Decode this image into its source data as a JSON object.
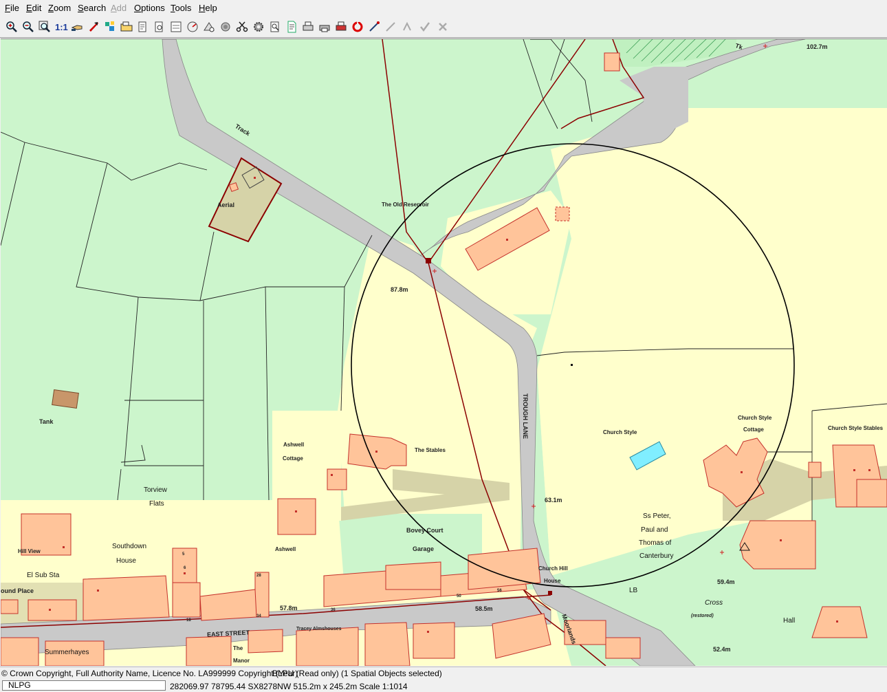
{
  "menu": [
    {
      "label": "File",
      "u": "F",
      "rest": "ile",
      "enabled": true
    },
    {
      "label": "Edit",
      "u": "E",
      "rest": "dit",
      "enabled": true
    },
    {
      "label": "Zoom",
      "u": "Z",
      "rest": "oom",
      "enabled": true
    },
    {
      "label": "Search",
      "u": "S",
      "rest": "earch",
      "enabled": true
    },
    {
      "label": "Add",
      "u": "A",
      "rest": "dd",
      "enabled": false
    },
    {
      "label": "Options",
      "u": "O",
      "rest": "ptions",
      "enabled": true
    },
    {
      "label": "Tools",
      "u": "T",
      "rest": "ools",
      "enabled": true
    },
    {
      "label": "Help",
      "u": "H",
      "rest": "elp",
      "enabled": true
    }
  ],
  "toolbar": {
    "scale_label": "1:1",
    "icons": [
      "zoom-in-icon",
      "zoom-out-icon",
      "zoom-extent-icon",
      "scale-1-1",
      "pan-hand-icon",
      "select-arrow-icon",
      "layers-icon",
      "folder-icon",
      "identify-icon",
      "query-icon",
      "map-sheet-icon",
      "measure-icon",
      "gazetteer-icon",
      "tools-icon",
      "scissors-icon",
      "gear-icon",
      "print-preview-icon",
      "document-icon",
      "print-icon",
      "printer-icon",
      "plot-icon",
      "refresh-icon",
      "snap-icon",
      "vertex-icon",
      "line-icon",
      "ok-icon",
      "cancel-icon"
    ]
  },
  "map": {
    "labels": {
      "track": "Track",
      "tk": "Tk",
      "height_top": "102.7m",
      "aerial": "Aerial",
      "old_reservoir": "The Old Reservoir",
      "height_mid": "87.8m",
      "tank": "Tank",
      "trough_lane": "TROUGH LANE",
      "church_style": "Church Style",
      "church_style_cottage_1": "Church Style",
      "church_style_cottage_2": "Cottage",
      "church_style_stables": "Church Style Stables",
      "ashwell_cottage_1": "Ashwell",
      "ashwell_cottage_2": "Cottage",
      "the_stables": "The Stables",
      "torview_1": "Torview",
      "torview_2": "Flats",
      "height_631": "63.1m",
      "church_1": "Ss Peter,",
      "church_2": "Paul and",
      "church_3": "Thomas of",
      "church_4": "Canterbury",
      "hill_view": "Hill View",
      "southdown_1": "Southdown",
      "southdown_2": "House",
      "ashwell": "Ashwell",
      "bovey_court": "Bovey Court",
      "garage": "Garage",
      "church_hill_1": "Church Hill",
      "church_hill_2": "House",
      "el_sub_sta": "El Sub Sta",
      "bound_place": "ound Place",
      "lb": "LB",
      "height_594": "59.4m",
      "cross": "Cross",
      "restored": "(restored)",
      "height_578": "57.8m",
      "height_585": "58.5m",
      "east_street": "EAST STREET",
      "almshouses": "Tracey Almshouses",
      "hall": "Hall",
      "summerhayes": "Summerhayes",
      "the": "The",
      "manor": "Manor",
      "moorlands": "Moorlands",
      "height_524": "52.4m",
      "n5": "5",
      "n6": "6",
      "n28": "28",
      "n18": "18",
      "n34": "34",
      "n36": "36",
      "n50": "50",
      "n56": "56"
    },
    "colors": {
      "field_green": "#ccf5cc",
      "yellow_parcel": "#ffffcc",
      "building": "#ffc49a",
      "building_outline": "#c4302a",
      "road": "#c9c9c9",
      "boundary": "#8b0000",
      "olive": "#d6d3a8",
      "pool": "#80eeff"
    }
  },
  "status": {
    "copyright": "© Crown Copyright, Full Authority Name, Licence No. LA999999 Copyright (Year)",
    "mode": "BLPU (Read only) (1 Spatial Objects selected)",
    "layer": "NLPG",
    "coords": "282069.97 78795.44 SX8278NW 515.2m x 245.2m Scale 1:1014"
  }
}
